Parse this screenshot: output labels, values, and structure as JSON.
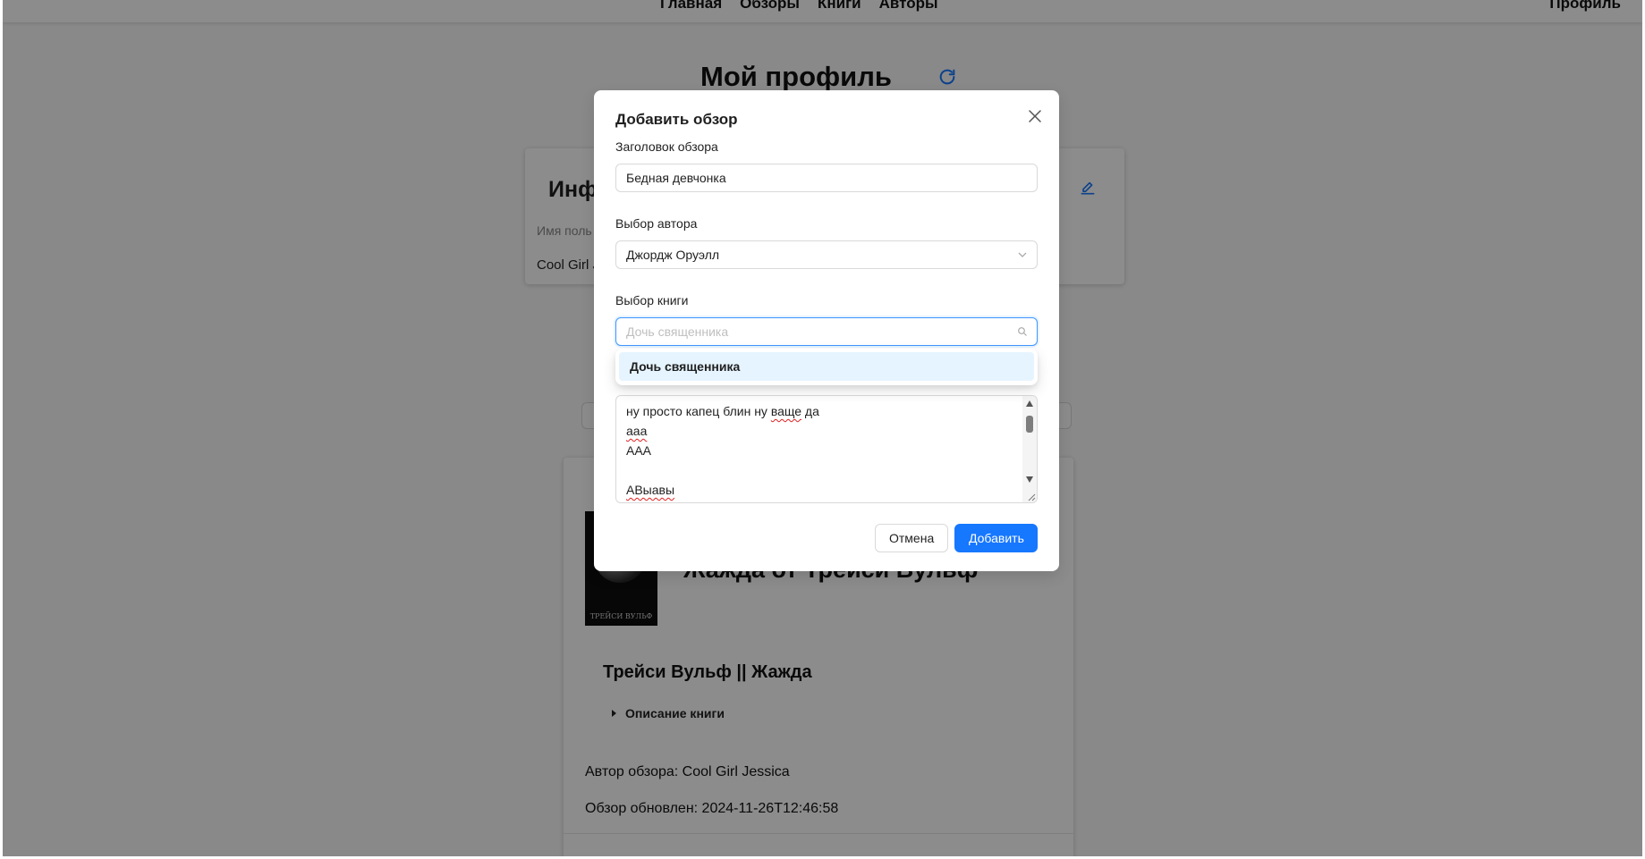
{
  "nav": {
    "links": [
      "Главная",
      "Обзоры",
      "Книги",
      "Авторы"
    ],
    "profile": "Профиль"
  },
  "page": {
    "title": "Мой профиль",
    "info_title": "Инф",
    "username_label": "Имя поль",
    "username_value": "Cool Girl J"
  },
  "review": {
    "cover_text": "ТРЕЙСИ ВУЛЬФ",
    "heading": "Жажда от Трейси Вульф",
    "subtitle": "Трейси Вульф || Жажда",
    "description_toggle": "Описание книги",
    "author": "Автор обзора: Cool Girl Jessica",
    "updated": "Обзор обновлен: 2024-11-26T12:46:58"
  },
  "modal": {
    "title": "Добавить обзор",
    "title_label": "Заголовок обзора",
    "title_value": "Бедная девчонка",
    "author_label": "Выбор автора",
    "author_value": "Джордж Оруэлл",
    "book_label": "Выбор книги",
    "book_placeholder": "Дочь священника",
    "dropdown_option": "Дочь священника",
    "text_lines": [
      "ну просто капец блин ну ",
      "ваще",
      " да",
      "ааа",
      "ААА",
      "",
      "АВыавы"
    ],
    "cancel": "Отмена",
    "add": "Добавить"
  },
  "colors": {
    "primary": "#1677ff",
    "focus_border": "#4096ff",
    "option_bg": "#e6f4ff"
  },
  "icons": [
    "refresh-icon",
    "edit-icon",
    "close-icon",
    "chevron-down-icon",
    "search-icon"
  ]
}
